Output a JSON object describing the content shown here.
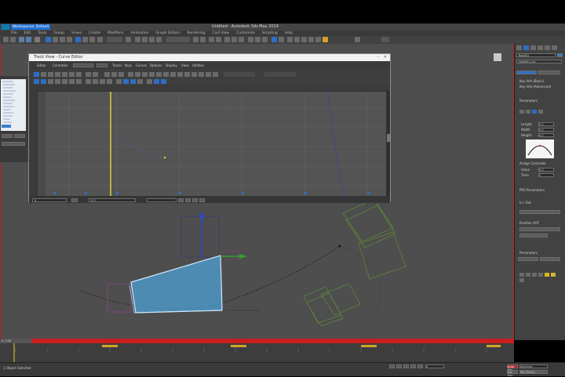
{
  "window": {
    "title": "Untitled - Autodesk 3ds Max 2019",
    "search_placeholder": "Type a keyword or phrase",
    "workspaces_label": "Workspaces: Default"
  },
  "menu": {
    "items": [
      "File",
      "Edit",
      "Tools",
      "Group",
      "Views",
      "Create",
      "Modifiers",
      "Animation",
      "Graph Editors",
      "Rendering",
      "Civil View",
      "Customize",
      "Scripting",
      "Help"
    ]
  },
  "curve_editor": {
    "title": "Track View - Curve Editor",
    "menu_items": [
      "Editor",
      "Controller",
      "Tracks",
      "Keys",
      "Curves",
      "Options",
      "Display",
      "View",
      "Utilities"
    ],
    "tracks": [
      "World",
      "Sound",
      "Environment",
      "Render Effects",
      "Render Elements",
      "Renderer",
      "Global Tracks",
      "Video Post",
      "Anim Layer Control",
      "Box001",
      "Transform",
      "Position",
      "X Position",
      "Y Position",
      "Z Position",
      "Rotation",
      "Scale",
      "Object (Box)",
      "Modified Object"
    ],
    "frame_field": "0",
    "value_field": "0.0"
  },
  "command_panel": {
    "object_name": "Box001",
    "modifier_list": "Modifier List",
    "rollout_labels": [
      "Key Info (Basic)",
      "Key Info (Advanced)",
      "Parameters",
      "Assign Controller",
      "PRS Parameters",
      "Position XYZ",
      "Parameters"
    ],
    "fields": [
      {
        "label": "Length",
        "value": "0.0"
      },
      {
        "label": "Width",
        "value": "0.0"
      },
      {
        "label": "Height",
        "value": "0.0"
      },
      {
        "label": "Value",
        "value": "0.0"
      },
      {
        "label": "Time",
        "value": "0"
      }
    ],
    "tangent_label": "In / Out"
  },
  "timeline": {
    "range_label": "0 / 100"
  },
  "status": {
    "selection": "1 Object Selected",
    "auto_key": "Auto Key",
    "selected": "Selected",
    "set_key": "Set Key",
    "key_filters": "Key Filters...",
    "frame": "0"
  },
  "colors": {
    "accent": "#3a8fd8",
    "selection": "#cfe8ff",
    "auto_key_red": "#c02020",
    "timeline_red": "#c81e1e",
    "key_yellow": "#e0b020"
  }
}
